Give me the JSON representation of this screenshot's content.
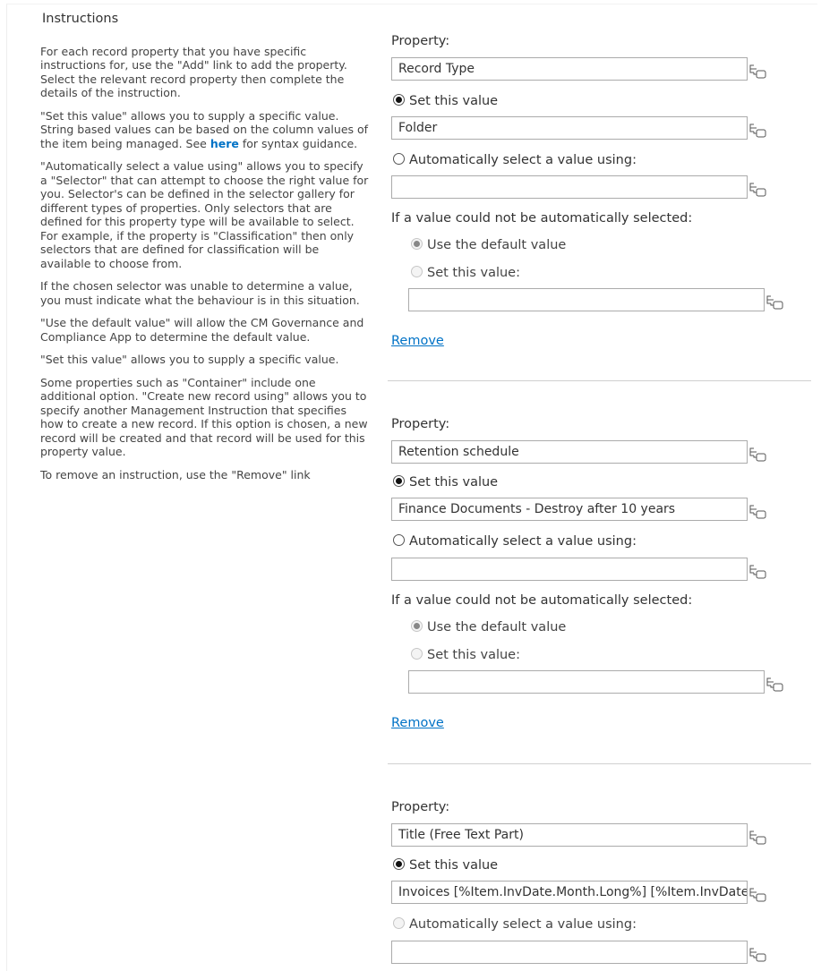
{
  "instructions": {
    "title": "Instructions",
    "p1": "For each record property that you have specific instructions for, use the \"Add\" link to add the property. Select the relevant record property then complete the details of the instruction.",
    "p2_before": "\"Set this value\" allows you to supply a specific value. String based values can be based on the column values of the item being managed. See ",
    "p2_link": "here",
    "p2_after": " for syntax guidance.",
    "p3": "\"Automatically select a value using\" allows you to specify a \"Selector\" that can attempt to choose the right value for you. Selector's can be defined in the selector gallery for different types of properties. Only selectors that are defined for this property type will be available to select. For example, if the property is \"Classification\" then only selectors that are defined for classification will be available to choose from.",
    "p4": "If the chosen selector was unable to determine a value, you must indicate what the behaviour is in this situation.",
    "p5": "\"Use the default value\" will allow the CM Governance and Compliance App to determine the default value.",
    "p6": "\"Set this value\" allows you to supply a specific value.",
    "p7": "Some properties such as \"Container\" include one additional option. \"Create new record using\" allows you to specify another Management Instruction that specifies how to create a new record. If this option is chosen, a new record will be created and that record will be used for this property value.",
    "p8": "To remove an instruction, use the \"Remove\" link"
  },
  "labels": {
    "property": "Property:",
    "set_value": "Set this value",
    "auto_select": "Automatically select a value using:",
    "fallback": "If a value could not be automatically selected:",
    "use_default": "Use the default value",
    "set_value_colon": "Set this value:",
    "remove": "Remove"
  },
  "sections": [
    {
      "property": "Record Type",
      "value": "Folder",
      "selector": "",
      "fallback_value": ""
    },
    {
      "property": "Retention schedule",
      "value": "Finance Documents - Destroy after 10 years",
      "selector": "",
      "fallback_value": ""
    },
    {
      "property": "Title (Free Text Part)",
      "value": "Invoices [%Item.InvDate.Month.Long%] [%Item.InvDate",
      "selector": ""
    }
  ],
  "icons": {
    "picker": "term-picker-icon"
  }
}
